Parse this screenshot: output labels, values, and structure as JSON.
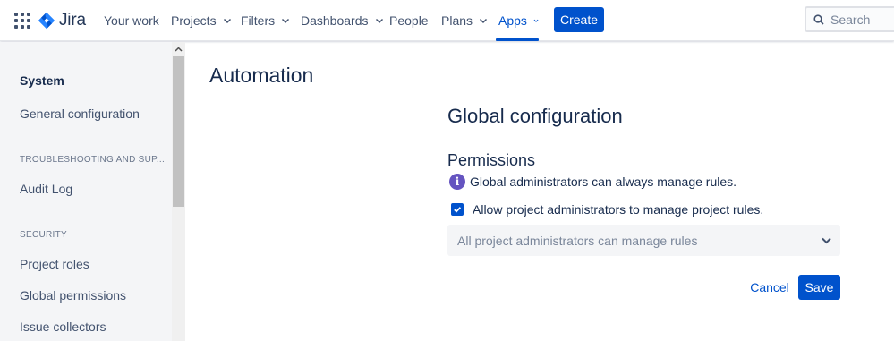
{
  "topbar": {
    "logo_text": "Jira",
    "nav": [
      {
        "label": "Your work"
      },
      {
        "label": "Projects"
      },
      {
        "label": "Filters"
      },
      {
        "label": "Dashboards"
      },
      {
        "label": "People"
      },
      {
        "label": "Plans"
      },
      {
        "label": "Apps"
      }
    ],
    "create_label": "Create",
    "search_placeholder": "Search",
    "active_nav": "Apps"
  },
  "sidebar": {
    "items": [
      {
        "label": "System"
      },
      {
        "label": "General configuration"
      },
      {
        "label": "TROUBLESHOOTING AND SUP..."
      },
      {
        "label": "Audit Log"
      },
      {
        "label": "SECURITY"
      },
      {
        "label": "Project roles"
      },
      {
        "label": "Global permissions"
      },
      {
        "label": "Issue collectors"
      }
    ]
  },
  "main": {
    "page_title": "Automation",
    "section_title": "Global configuration",
    "permissions_title": "Permissions",
    "info_text": "Global administrators can always manage rules.",
    "checkbox_label": "Allow project administrators to manage project rules.",
    "checkbox_checked": true,
    "select_value": "All project administrators can manage rules",
    "cancel_label": "Cancel",
    "save_label": "Save"
  },
  "colors": {
    "brand": "#0052cc",
    "info": "#6554c0",
    "sidebar_bg": "#f4f5f7",
    "text": "#172b4d"
  },
  "icons": [
    "app-switcher-icon",
    "jira-logo-icon",
    "chevron-down-icon",
    "search-icon",
    "info-icon",
    "checkmark-icon",
    "scroll-up-arrow-icon"
  ]
}
